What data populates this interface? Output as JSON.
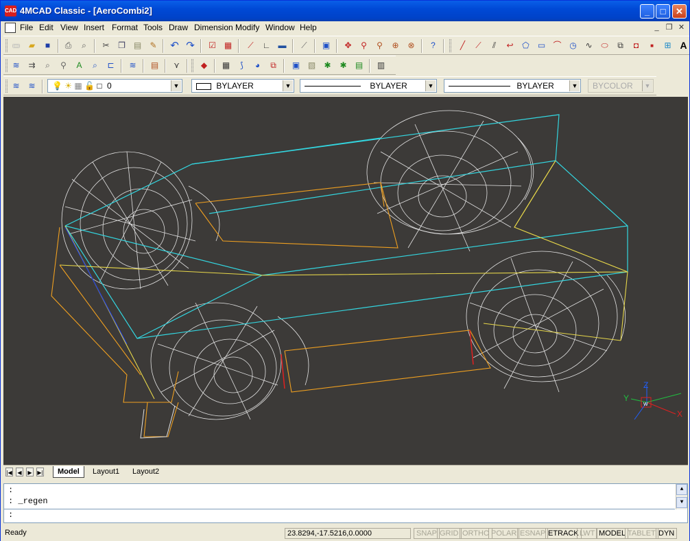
{
  "window": {
    "title": "4MCAD Classic  - [AeroCombi2]",
    "app_icon_text": "CAD"
  },
  "menu": [
    "File",
    "Edit",
    "View",
    "Insert",
    "Format",
    "Tools",
    "Draw",
    "Dimension",
    "Modify",
    "Window",
    "Help"
  ],
  "toolbar3": {
    "layer_value": "0",
    "color_value": "BYLAYER",
    "linetype_value": "BYLAYER",
    "lineweight_value": "BYLAYER",
    "plotstyle_value": "BYCOLOR"
  },
  "toolbar1": {
    "text_icon": "A"
  },
  "tabs": {
    "model": "Model",
    "layout1": "Layout1",
    "layout2": "Layout2"
  },
  "ucs": {
    "x": "X",
    "y": "Y",
    "z": "Z",
    "w": "W"
  },
  "command": {
    "line1": ":",
    "line2": ": _regen",
    "prompt": ":"
  },
  "status": {
    "ready": "Ready",
    "coords": "23.8294,-17.5216,0.0000",
    "toggles": [
      {
        "label": "SNAP",
        "on": false
      },
      {
        "label": "GRID",
        "on": false
      },
      {
        "label": "ORTHO",
        "on": false
      },
      {
        "label": "POLAR",
        "on": false
      },
      {
        "label": "ESNAP",
        "on": false
      },
      {
        "label": "ETRACK",
        "on": true
      },
      {
        "label": "LWT",
        "on": false
      },
      {
        "label": "MODEL",
        "on": true
      },
      {
        "label": "TABLET",
        "on": false
      },
      {
        "label": "DYN",
        "on": true
      }
    ]
  },
  "colors": {
    "viewport_bg": "#3c3a38",
    "cyan": "#33d6e0",
    "orange": "#f0a020",
    "yellow": "#e8d84a",
    "white": "#e8e8e8",
    "titlebar": "#0049d6"
  }
}
